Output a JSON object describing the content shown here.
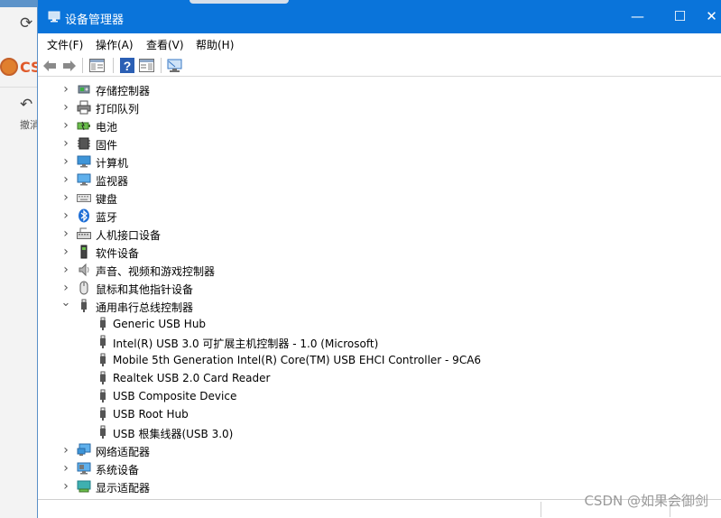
{
  "background_app": {
    "brand_text": "CS",
    "undo_label": "撤消"
  },
  "window": {
    "title": "设备管理器",
    "controls": {
      "minimize": "—",
      "maximize": "☐",
      "close": "✕"
    }
  },
  "menu": [
    "文件(F)",
    "操作(A)",
    "查看(V)",
    "帮助(H)"
  ],
  "toolbar": [
    "back-icon",
    "forward-icon",
    "properties-pane-icon",
    "help-icon",
    "action-pane-icon",
    "monitor-scan-icon"
  ],
  "tree": [
    {
      "label": "存储控制器",
      "icon": "storage-controller-icon",
      "expanded": false
    },
    {
      "label": "打印队列",
      "icon": "printer-icon",
      "expanded": false
    },
    {
      "label": "电池",
      "icon": "battery-icon",
      "expanded": false
    },
    {
      "label": "固件",
      "icon": "firmware-icon",
      "expanded": false
    },
    {
      "label": "计算机",
      "icon": "computer-icon",
      "expanded": false
    },
    {
      "label": "监视器",
      "icon": "monitor-icon",
      "expanded": false
    },
    {
      "label": "键盘",
      "icon": "keyboard-icon",
      "expanded": false
    },
    {
      "label": "蓝牙",
      "icon": "bluetooth-icon",
      "expanded": false
    },
    {
      "label": "人机接口设备",
      "icon": "hid-icon",
      "expanded": false
    },
    {
      "label": "软件设备",
      "icon": "software-device-icon",
      "expanded": false
    },
    {
      "label": "声音、视频和游戏控制器",
      "icon": "speaker-icon",
      "expanded": false
    },
    {
      "label": "鼠标和其他指针设备",
      "icon": "mouse-icon",
      "expanded": false
    },
    {
      "label": "通用串行总线控制器",
      "icon": "usb-icon",
      "expanded": true,
      "children": [
        "Generic USB Hub",
        "Intel(R) USB 3.0 可扩展主机控制器 - 1.0 (Microsoft)",
        "Mobile 5th Generation Intel(R) Core(TM) USB EHCI Controller - 9CA6",
        "Realtek USB 2.0 Card Reader",
        "USB Composite Device",
        "USB Root Hub",
        "USB 根集线器(USB 3.0)"
      ]
    },
    {
      "label": "网络适配器",
      "icon": "network-adapter-icon",
      "expanded": false
    },
    {
      "label": "系统设备",
      "icon": "system-device-icon",
      "expanded": false
    },
    {
      "label": "显示适配器",
      "icon": "display-adapter-icon",
      "expanded": false
    }
  ],
  "watermark": "CSDN @如果会御剑"
}
